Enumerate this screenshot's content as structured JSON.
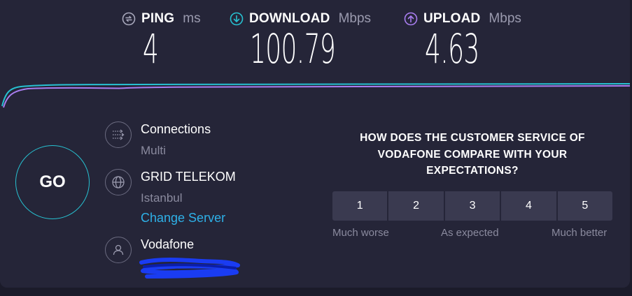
{
  "metrics": {
    "ping": {
      "name": "PING",
      "unit": "ms",
      "value": "4",
      "icon": "ping-icon",
      "color": "#a8a8bc"
    },
    "download": {
      "name": "DOWNLOAD",
      "unit": "Mbps",
      "value": "100.79",
      "icon": "download-arrow-icon",
      "color": "#27c1d1"
    },
    "upload": {
      "name": "UPLOAD",
      "unit": "Mbps",
      "value": "4.63",
      "icon": "upload-arrow-icon",
      "color": "#a97ef0"
    }
  },
  "go_button": {
    "label": "GO"
  },
  "connections": {
    "title": "Connections",
    "value": "Multi",
    "icon": "connections-icon"
  },
  "server": {
    "title": "GRID TELEKOM",
    "location": "Istanbul",
    "change_link": "Change Server",
    "icon": "globe-icon"
  },
  "provider": {
    "name": "Vodafone",
    "icon": "user-icon"
  },
  "survey": {
    "question": "HOW DOES THE CUSTOMER SERVICE OF VODAFONE COMPARE WITH YOUR EXPECTATIONS?",
    "options": [
      "1",
      "2",
      "3",
      "4",
      "5"
    ],
    "labels": {
      "low": "Much worse",
      "mid": "As expected",
      "high": "Much better"
    }
  },
  "colors": {
    "accent_download": "#27c1d1",
    "accent_upload": "#a97ef0",
    "link": "#2eb1e8",
    "background": "#252538"
  }
}
